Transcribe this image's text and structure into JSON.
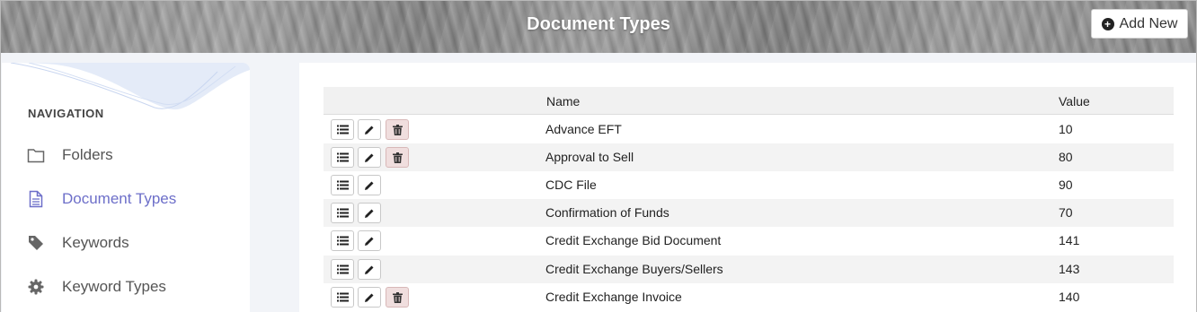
{
  "header": {
    "title": "Document Types",
    "add_button_label": "Add New"
  },
  "sidebar": {
    "heading": "NAVIGATION",
    "items": [
      {
        "label": "Folders",
        "icon": "folder-icon",
        "active": false
      },
      {
        "label": "Document Types",
        "icon": "document-icon",
        "active": true
      },
      {
        "label": "Keywords",
        "icon": "tag-icon",
        "active": false
      },
      {
        "label": "Keyword Types",
        "icon": "gear-icon",
        "active": false
      }
    ]
  },
  "table": {
    "columns": [
      "Name",
      "Value"
    ],
    "rows": [
      {
        "name": "Advance EFT",
        "value": "10",
        "deletable": true
      },
      {
        "name": "Approval to Sell",
        "value": "80",
        "deletable": true
      },
      {
        "name": "CDC File",
        "value": "90",
        "deletable": false
      },
      {
        "name": "Confirmation of Funds",
        "value": "70",
        "deletable": false
      },
      {
        "name": "Credit Exchange Bid Document",
        "value": "141",
        "deletable": false
      },
      {
        "name": "Credit Exchange Buyers/Sellers",
        "value": "143",
        "deletable": false
      },
      {
        "name": "Credit Exchange Invoice",
        "value": "140",
        "deletable": true
      }
    ]
  },
  "colors": {
    "accent": "#6d6fc9",
    "delete_bg": "#f0dede"
  }
}
